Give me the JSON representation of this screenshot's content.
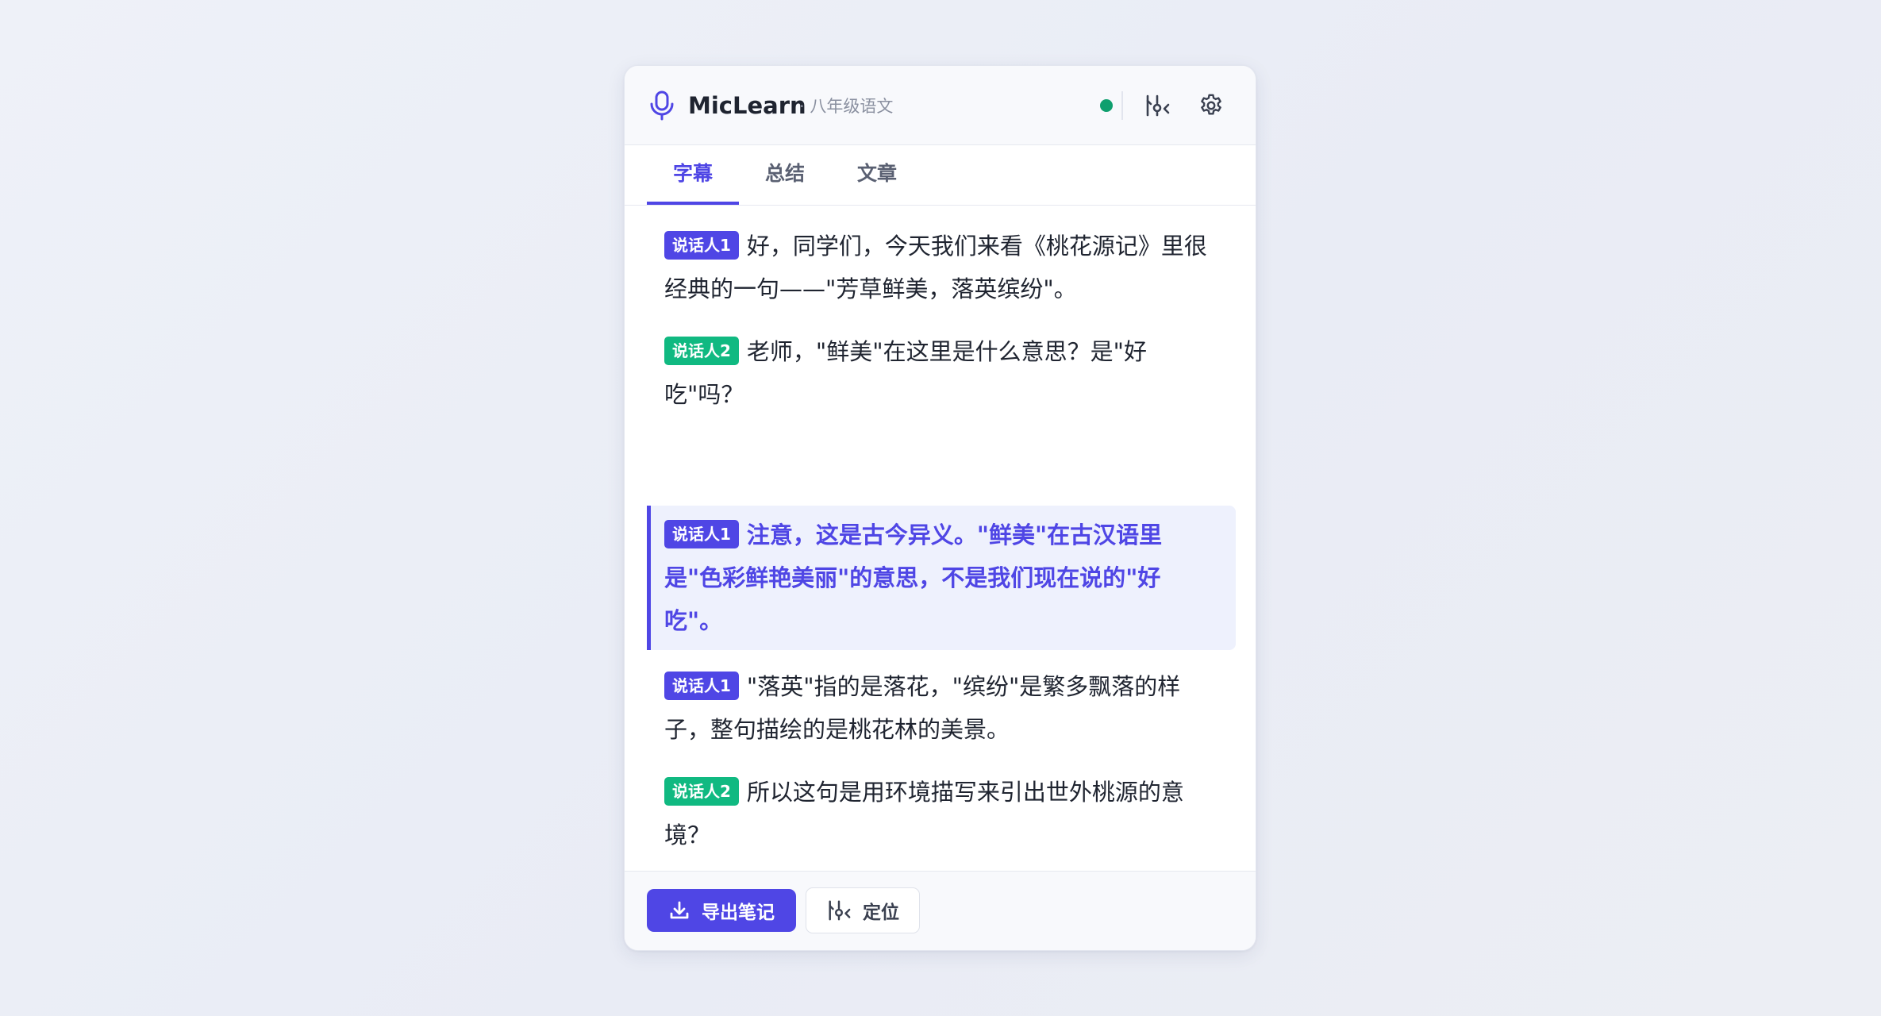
{
  "header": {
    "title": "MicLearn",
    "subtitle": "· 八年级语文",
    "status_color": "#0f9f6e",
    "icons": [
      "mic-icon",
      "locate-icon",
      "gear-icon"
    ]
  },
  "tabs": [
    {
      "label": "字幕",
      "active": true
    },
    {
      "label": "总结",
      "active": false
    },
    {
      "label": "文章",
      "active": false
    }
  ],
  "transcript": [
    {
      "speaker": "说话人1",
      "text": "好，同学们，今天我们来看《桃花源记》里很经典的一句——\"芳草鲜美，落英缤纷\"。"
    },
    {
      "speaker": "说话人2",
      "text": "老师，\"鲜美\"在这里是什么意思？是\"好吃\"吗？"
    },
    {
      "speaker": "说话人1",
      "text": "注意，这是古今异义。\"鲜美\"在古汉语里是\"色彩鲜艳美丽\"的意思，不是我们现在说的\"好吃\"。",
      "highlighted": true
    },
    {
      "speaker": "说话人1",
      "text": "\"落英\"指的是落花，\"缤纷\"是繁多飘落的样子，整句描绘的是桃花林的美景。"
    },
    {
      "speaker": "说话人2",
      "text": "所以这句是用环境描写来引出世外桃源的意境？"
    }
  ],
  "footer": {
    "export_label": "导出笔记",
    "locate_label": "定位"
  },
  "colors": {
    "accent": "#4f46e5",
    "speaker2": "#10b981",
    "highlight_bg": "#eef1fd"
  }
}
